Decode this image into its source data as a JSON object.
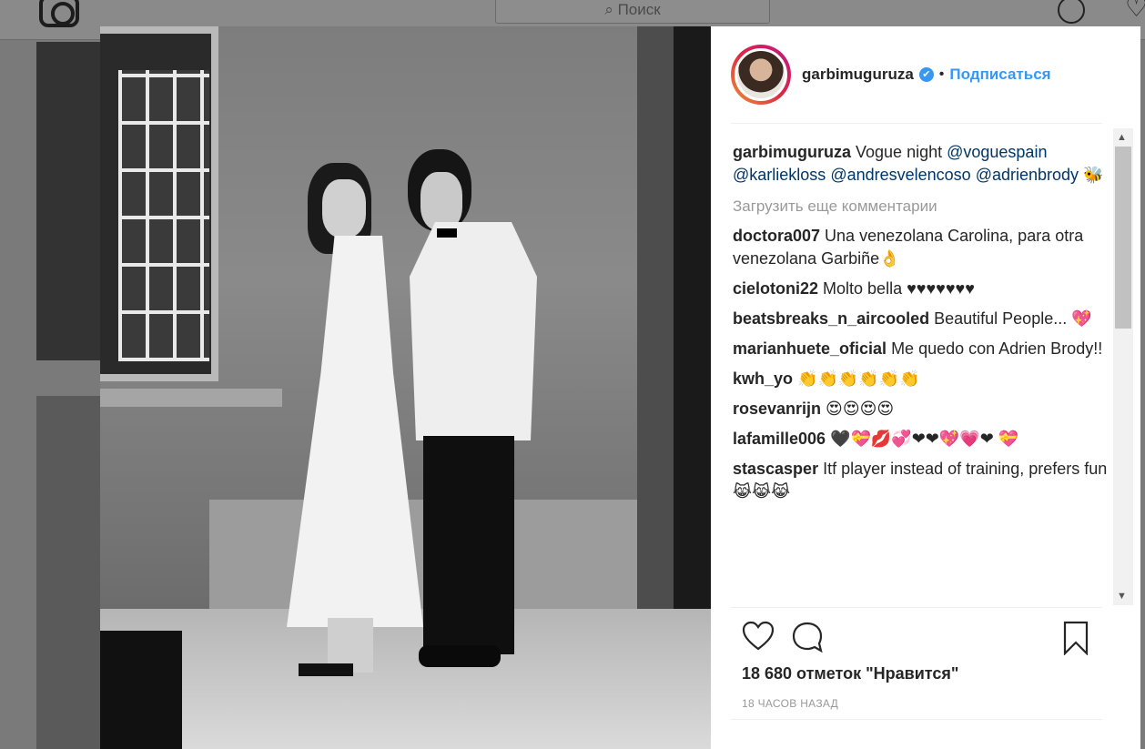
{
  "background": {
    "search_placeholder": "Поиск"
  },
  "post": {
    "username": "garbimuguruza",
    "verified_glyph": "✔",
    "separator": "•",
    "follow_label": "Подписаться",
    "load_more_label": "Загрузить еще комментарии",
    "likes_text": "18 680 отметок \"Нравится\"",
    "time_text": "18 часов назад"
  },
  "caption": {
    "user": "garbimuguruza",
    "text_prefix": " Vogue night ",
    "mentions": [
      "@voguespain",
      "@karliekloss",
      "@andresvelencoso",
      "@adrienbrody"
    ],
    "emoji": "🐝"
  },
  "comments": [
    {
      "user": "doctora007",
      "text": " Una venezolana Carolina, para otra venezolana Garbiñe👌"
    },
    {
      "user": "cielotoni22",
      "text": " Molto bella ♥♥♥♥♥♥♥"
    },
    {
      "user": "beatsbreaks_n_aircooled",
      "text": " Beautiful People... 💖"
    },
    {
      "user": "marianhuete_oficial",
      "text": " Me quedo con Adrien Brody!!"
    },
    {
      "user": "kwh_yo",
      "text": " 👏👏👏👏👏👏"
    },
    {
      "user": "rosevanrijn",
      "text": " 😍😍😍😍"
    },
    {
      "user": "lafamille006",
      "text": " 🖤💝💋💞❤❤💖💗❤ 💝"
    },
    {
      "user": "stascasper",
      "text": " Itf player instead of training, prefers fun😹😹😹"
    }
  ],
  "icons": {
    "like": "heart-icon",
    "comment": "comment-icon",
    "save": "bookmark-icon",
    "scroll_up": "▲",
    "scroll_down": "▼"
  },
  "colors": {
    "accent": "#3897f0",
    "text": "#262626",
    "muted": "#999999",
    "mention": "#003569"
  }
}
